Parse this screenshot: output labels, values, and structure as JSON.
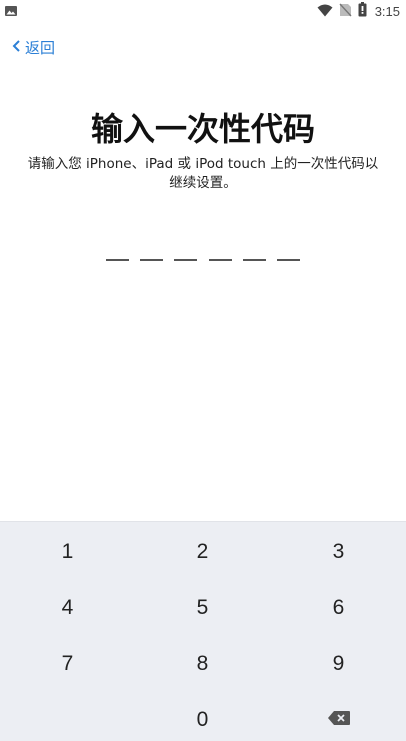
{
  "status_bar": {
    "time": "3:15",
    "icons": [
      "image-notification-icon",
      "wifi-icon",
      "no-sim-icon",
      "battery-icon"
    ]
  },
  "nav": {
    "back_label": "返回"
  },
  "header": {
    "title": "输入一次性代码",
    "subtitle_line1": "请输入您 iPhone、iPad 或 iPod touch 上的一次性代码以",
    "subtitle_line2": "继续设置。"
  },
  "code_input": {
    "length": 6,
    "digits": [
      "",
      "",
      "",
      "",
      "",
      ""
    ]
  },
  "keypad": {
    "keys": [
      "1",
      "2",
      "3",
      "4",
      "5",
      "6",
      "7",
      "8",
      "9",
      "0"
    ],
    "delete_icon": "backspace-icon"
  },
  "colors": {
    "accent": "#2b7fd6",
    "keypad_bg": "#eceef3",
    "text": "#111111"
  }
}
